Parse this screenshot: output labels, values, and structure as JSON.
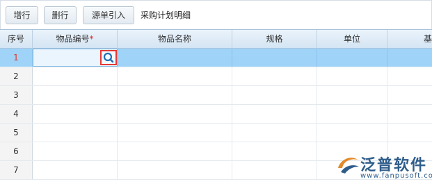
{
  "toolbar": {
    "add_row": "增行",
    "delete_row": "删行",
    "source_import": "源单引入",
    "title": "采购计划明细"
  },
  "table": {
    "columns": {
      "seq": "序号",
      "item_code": "物品编号",
      "item_code_required": "*",
      "item_name": "物品名称",
      "spec": "规格",
      "unit": "单位",
      "extra": "基"
    },
    "rows": [
      "1",
      "2",
      "3",
      "4",
      "5",
      "6",
      "7"
    ]
  },
  "watermark": {
    "brand": "泛普软件",
    "url": "www.fanpusoft.com"
  },
  "colors": {
    "selected_row": "#9fd3f8",
    "selected_row_number": "#e0392b",
    "required_marker": "#e02020",
    "lookup_highlight": "#e53935"
  }
}
